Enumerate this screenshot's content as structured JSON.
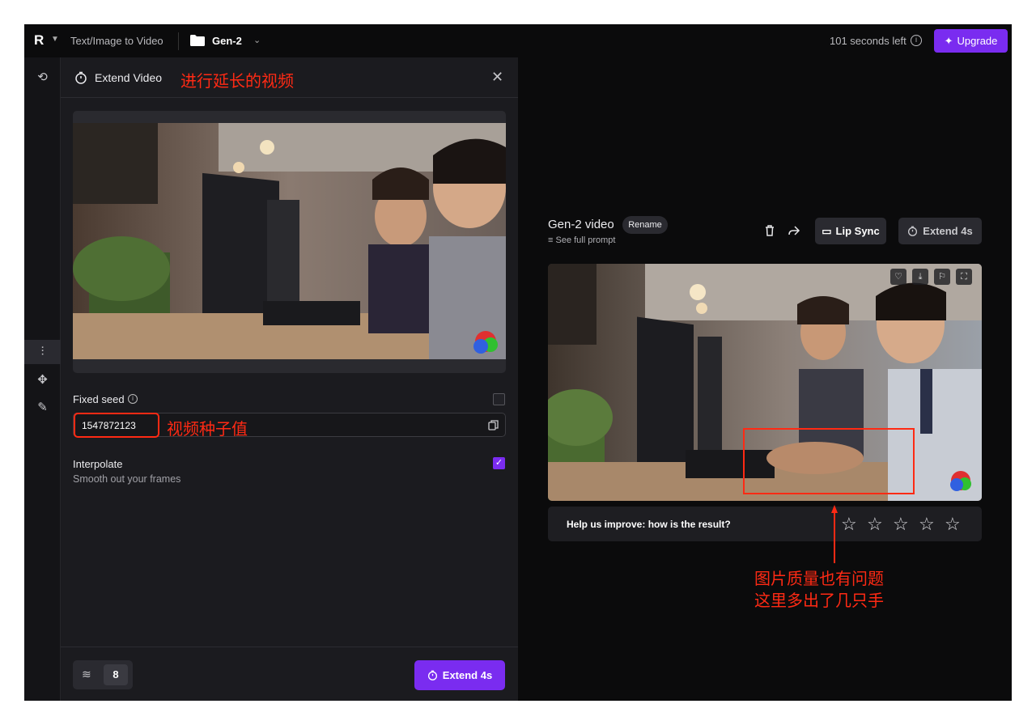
{
  "topbar": {
    "logo": "R",
    "breadcrumb": "Text/Image to Video",
    "project": "Gen-2",
    "time_left": "101 seconds left",
    "upgrade_label": "Upgrade"
  },
  "panel": {
    "title": "Extend Video",
    "annotation_title": "进行延长的视频",
    "fixed_seed_label": "Fixed seed",
    "seed_value": "1547872123",
    "annotation_seed": "视频种子值",
    "interpolate_label": "Interpolate",
    "interpolate_sub": "Smooth out your frames",
    "duration_value": "8",
    "extend_label": "Extend 4s"
  },
  "result": {
    "title": "Gen-2 video",
    "rename_label": "Rename",
    "prompt_link": "See full prompt",
    "lip_sync_label": "Lip Sync",
    "extend_label": "Extend 4s",
    "rating_question": "Help us improve: how is the result?",
    "annotation_quality_1": "图片质量也有问题",
    "annotation_quality_2": "这里多出了几只手"
  },
  "colors": {
    "accent": "#7a2cf0",
    "annotation": "#ff2a14",
    "background": "#0b0b0c",
    "panel": "#1b1b1f"
  }
}
